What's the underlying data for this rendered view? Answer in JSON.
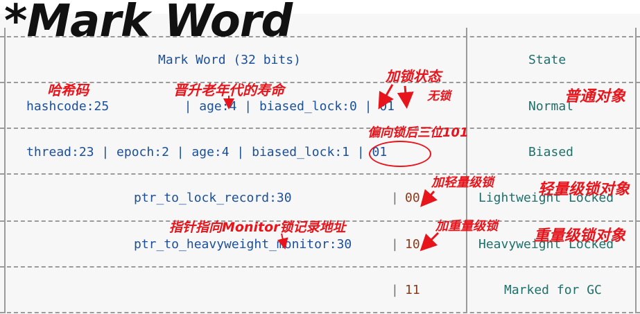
{
  "title": "*Mark Word",
  "header": {
    "col1": "Mark Word (32 bits)",
    "col2": "State"
  },
  "rows": [
    {
      "layout": "hashcode:25          | age:4 | biased_lock:0 | 01",
      "state": "Normal"
    },
    {
      "layout": "thread:23 | epoch:2 | age:4 | biased_lock:1 | 01",
      "state": "Biased"
    },
    {
      "layout": "ptr_to_lock_record:30",
      "bits": "00",
      "state": "Lightweight Locked"
    },
    {
      "layout": "ptr_to_heavyweight_monitor:30",
      "bits": "10",
      "state": "Heavyweight Locked"
    },
    {
      "layout": "",
      "bits": "11",
      "state": "Marked for GC"
    }
  ],
  "annotations": {
    "hashcode": "哈希码",
    "age": "晋升老年代的寿命",
    "lock_state": "加锁状态",
    "no_lock": "无锁",
    "normal_object": "普通对象",
    "biased_last3": "偏向锁后三位101",
    "add_light": "加轻量级锁",
    "light_object": "轻量级锁对象",
    "pointer": "指针指向Monitor锁记录地址",
    "add_heavy": "加重量级锁",
    "heavy_object": "重量级锁对象"
  }
}
